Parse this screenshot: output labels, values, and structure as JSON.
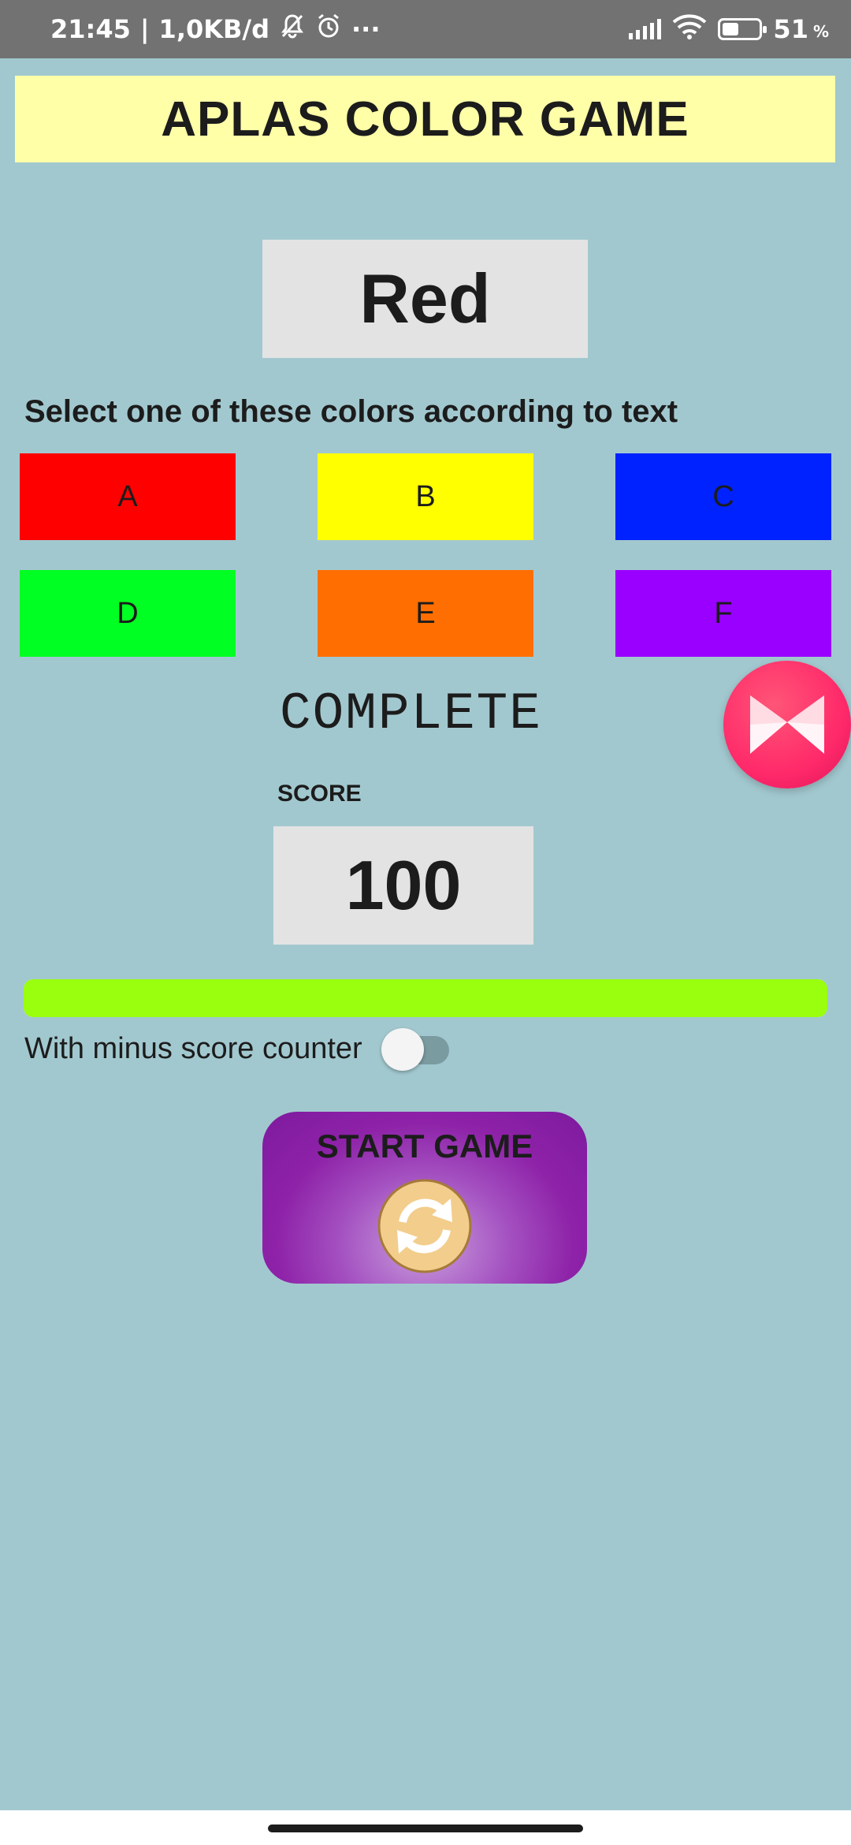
{
  "status_bar": {
    "time": "21:45",
    "separator": "|",
    "data_rate": "1,0KB/d",
    "more": "···",
    "battery_percent": "51",
    "battery_unit": "%",
    "battery_level": 0.51
  },
  "app": {
    "title": "APLAS COLOR GAME",
    "target_word": "Red",
    "instruction": "Select one of these colors according to text",
    "color_buttons": [
      {
        "label": "A",
        "color": "#ff0000"
      },
      {
        "label": "B",
        "color": "#ffff00"
      },
      {
        "label": "C",
        "color": "#0022ff"
      },
      {
        "label": "D",
        "color": "#00ff22"
      },
      {
        "label": "E",
        "color": "#ff6e00"
      },
      {
        "label": "F",
        "color": "#9900ff"
      }
    ],
    "status": "COMPLETE",
    "score_label": "SCORE",
    "score_value": "100",
    "progress": 1.0,
    "progress_color": "#99ff0e",
    "toggle_label": "With minus score counter",
    "toggle_on": false,
    "start_button_label": "START GAME"
  },
  "colors": {
    "background": "#a2c8cf",
    "title_bg": "#ffffa8",
    "box_bg": "#e3e3e3",
    "start_button": "#8e22a8",
    "bubble": "#ff2a6a"
  }
}
